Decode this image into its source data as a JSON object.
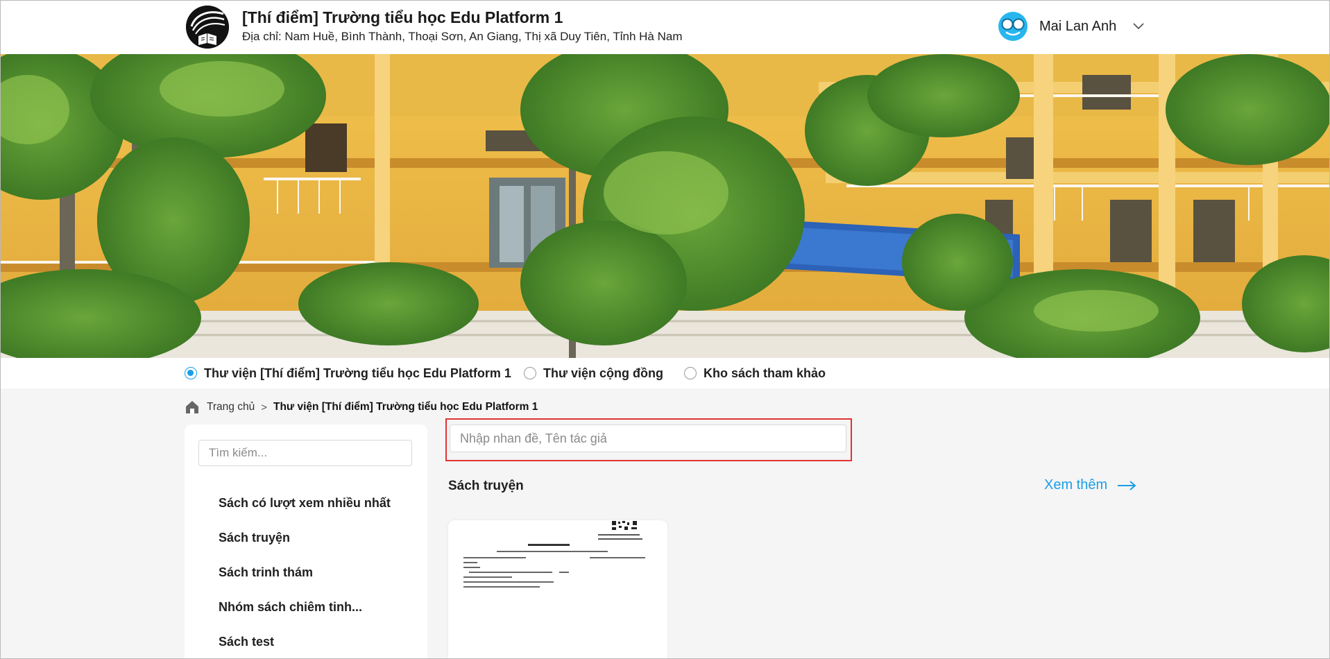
{
  "header": {
    "school_name": "[Thí điểm] Trường tiểu học Edu Platform 1",
    "address": "Địa chỉ: Nam Huề, Bình Thành, Thoại Sơn, An Giang, Thị xã Duy Tiên, Tỉnh Hà Nam",
    "logo_icon": "book-logo-icon",
    "user_name": "Mai Lan Anh",
    "avatar_icon": "glasses-face-avatar-icon",
    "menu_icon": "chevron-down-icon"
  },
  "banner": {
    "image": "school-building-photo"
  },
  "libraries": [
    {
      "label": "Thư viện [Thí điểm] Trường tiểu học Edu Platform 1",
      "selected": true
    },
    {
      "label": "Thư viện cộng đồng",
      "selected": false
    },
    {
      "label": "Kho sách tham khảo",
      "selected": false
    }
  ],
  "breadcrumb": {
    "home_icon": "home-icon",
    "home": "Trang chủ",
    "separator": ">",
    "current": "Thư viện [Thí điểm] Trường tiểu học Edu Platform 1"
  },
  "sidebar": {
    "search_placeholder": "Tìm kiếm...",
    "items": [
      {
        "label": "Sách có lượt xem nhiều nhất"
      },
      {
        "label": "Sách truyện"
      },
      {
        "label": "Sách trinh thám"
      },
      {
        "label": "Nhóm sách chiêm tinh..."
      },
      {
        "label": "Sách test"
      }
    ]
  },
  "main": {
    "search_placeholder": "Nhập nhan đề, Tên tác giả",
    "section_title": "Sách truyện",
    "see_more": "Xem thêm",
    "see_more_icon": "arrow-right-icon",
    "books": [
      {
        "cover": "library-notice-document-thumbnail"
      }
    ]
  },
  "colors": {
    "accent": "#1a9ee6",
    "highlight_border": "#e23232",
    "page_bg": "#f5f5f5"
  }
}
